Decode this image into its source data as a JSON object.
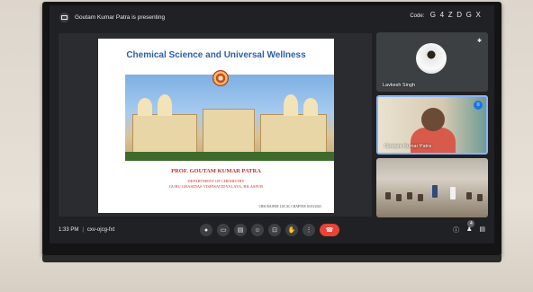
{
  "topbar": {
    "presenting_text": "Goutam Kumar Patra is presenting",
    "code_label": "Code:",
    "code_value": "G 4 Z D G X"
  },
  "slide": {
    "title": "Chemical Science and Universal Wellness",
    "presenter": "PROF. GOUTAM KUMAR PATRA",
    "department": "DEPARTMENT OF CHEMISTRY",
    "university": "GURU GHASIDAS VISHWAVIDYALAYA, BILASPUR",
    "footer": "CRSI RAIPUR LOCAL CHAPTER 10/03/2023"
  },
  "participants": [
    {
      "name": "Lavkesh Singh",
      "icon": "pin-icon"
    },
    {
      "name": "Goutam Kumar Patra",
      "icon": "speaking-icon"
    },
    {
      "name": ""
    }
  ],
  "bottombar": {
    "time": "1:33 PM",
    "separator": "|",
    "meeting_code": "cxv-ojcg-fxt",
    "people_count": "4",
    "controls": [
      "mic-icon",
      "camera-icon",
      "captions-icon",
      "emoji-icon",
      "present-icon",
      "raise-hand-icon",
      "more-icon",
      "end-call-icon"
    ],
    "right_icons": [
      "info-icon",
      "people-icon",
      "chat-icon"
    ]
  },
  "colors": {
    "meet_background": "#202124",
    "tile_background": "#3c4043",
    "end_call": "#ea4335",
    "active_speaker_border": "#8ab4f8",
    "slide_title": "#2f5fa8",
    "slide_name": "#b8332b"
  }
}
